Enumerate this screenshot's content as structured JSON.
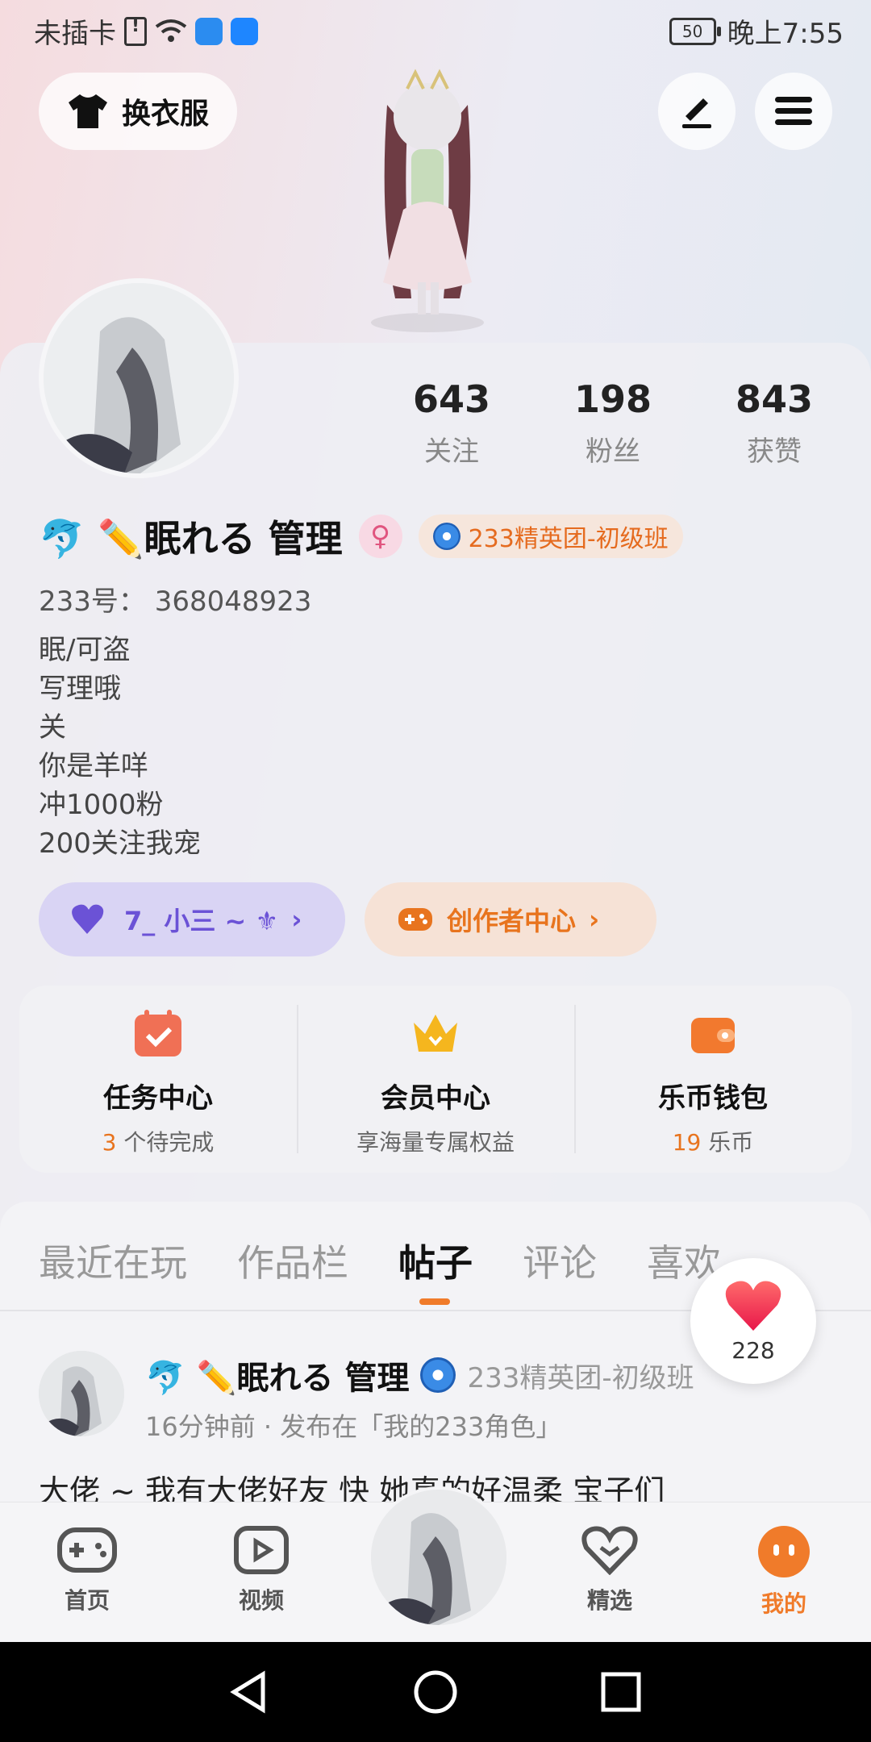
{
  "status_bar": {
    "carrier": "未插卡",
    "battery": "50",
    "time": "晚上7:55"
  },
  "header": {
    "dress_label": "换衣服"
  },
  "profile": {
    "stats": [
      {
        "value": "643",
        "label": "关注"
      },
      {
        "value": "198",
        "label": "粉丝"
      },
      {
        "value": "843",
        "label": "获赞"
      }
    ],
    "name": "🐬 ✏️眠れる  管理",
    "gender_symbol": "♀",
    "badge": "233精英团-初级班",
    "id_text": "233号： 368048923",
    "bio_lines": [
      "眠/可盗",
      "写理哦",
      "关",
      "你是羊咩",
      "冲1000粉",
      "200关注我宠"
    ],
    "fan_pill": "7_ 小三 ~ ⚜",
    "creator_pill": "创作者中心"
  },
  "quick": [
    {
      "title": "任务中心",
      "count": "3",
      "sub": " 个待完成"
    },
    {
      "title": "会员中心",
      "count": "",
      "sub": "享海量专属权益"
    },
    {
      "title": "乐币钱包",
      "count": "19",
      "sub": " 乐币"
    }
  ],
  "tabs": [
    "最近在玩",
    "作品栏",
    "帖子",
    "评论",
    "喜欢"
  ],
  "active_tab": "帖子",
  "like_count": "228",
  "post": {
    "name": "🐬 ✏️眠れる  管理",
    "badge": "233精英团-初级班",
    "meta": "16分钟前 · 发布在「我的233角色」",
    "text": "大佬 ~ 我有大佬好友 快      她真的好温柔 宝子们"
  },
  "nav": {
    "home": "首页",
    "video": "视频",
    "featured": "精选",
    "mine": "我的"
  },
  "colors": {
    "accent": "#f07b2a",
    "purple": "#6b52d6"
  }
}
